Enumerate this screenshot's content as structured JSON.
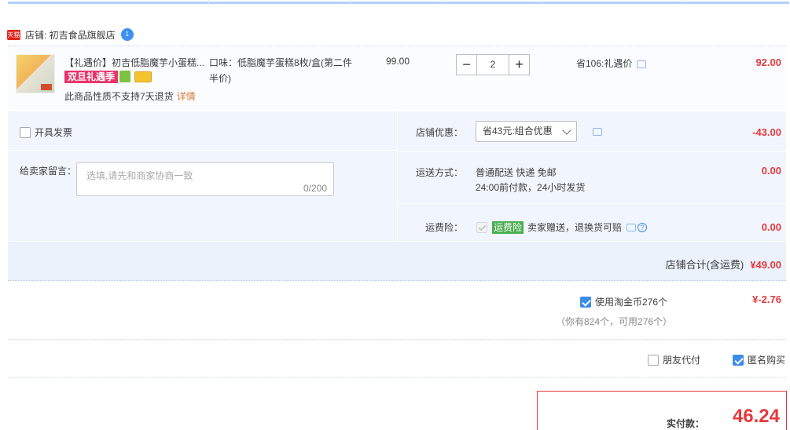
{
  "shop": {
    "badge": "天猫",
    "name": "店铺: 初吉食品旗舰店",
    "chat_badge": "1"
  },
  "item": {
    "title": "【礼遇价】初吉低脂魔芋小蛋糕...",
    "promo_badge": "双旦礼遇季",
    "return_note": "此商品性质不支持7天退货",
    "return_detail": "详情",
    "attr": "口味：低脂魔芋蛋糕8枚/盒(第二件半价)",
    "unit_price": "99.00",
    "qty_minus": "−",
    "qty_value": "2",
    "qty_plus": "+",
    "discount_note": "省106:礼遇价",
    "total": "92.00"
  },
  "invoice": {
    "label": "开具发票"
  },
  "memo": {
    "label": "给卖家留言：",
    "placeholder": "选填,请先和商家协商一致",
    "count": "0/200"
  },
  "coupon": {
    "label": "店铺优惠：",
    "selected": "省43元:组合优惠",
    "amount": "-43.00"
  },
  "shipping": {
    "label": "运送方式：",
    "line1": "普通配送 快递 免邮",
    "line2": "24:00前付款，24小时发货",
    "amount": "0.00"
  },
  "insurance": {
    "label": "运费险：",
    "badge": "运费险",
    "text": "卖家赠送，退换货可赔",
    "amount": "0.00"
  },
  "shop_total": {
    "label": "店铺合计(含运费)",
    "amount": "¥49.00"
  },
  "coins": {
    "label": "使用淘金币276个",
    "sub": "（你有824个，可用276个）",
    "amount": "¥-2.76"
  },
  "options": {
    "friend_pay": "朋友代付",
    "anonymous": "匿名购买"
  },
  "payment": {
    "label": "实付款：",
    "amount": "46.24"
  },
  "colors": {
    "accent_red": "#e4393c",
    "panel_bg": "#f1f5fd",
    "link_blue": "#3b8ce8"
  }
}
